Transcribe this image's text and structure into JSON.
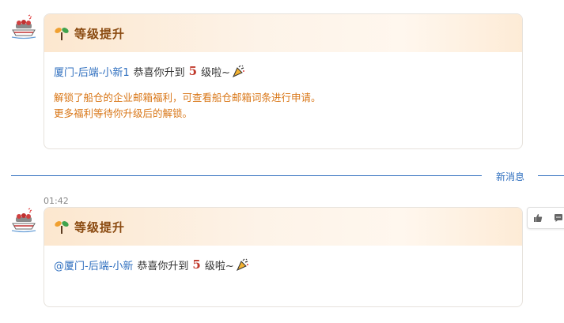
{
  "messages": [
    {
      "title": "等级提升",
      "user": "厦门-后端-小新1",
      "congrats": "恭喜你升到",
      "level": "5",
      "suffix": "级啦~",
      "benefits": [
        "解锁了船仓的企业邮箱福利，可查看船仓邮箱词条进行申请。",
        "更多福利等待你升级后的解锁。"
      ]
    },
    {
      "time": "01:42",
      "title": "等级提升",
      "user": "@厦门-后端-小新",
      "congrats": "恭喜你升到",
      "level": "5",
      "suffix": "级啦~"
    }
  ],
  "divider": {
    "label": "新消息"
  },
  "actions": [
    "thumbs-up-icon",
    "comment-icon"
  ],
  "colors": {
    "accent": "#2f6fbf",
    "benefit": "#d97718",
    "level": "#c0392b",
    "title": "#8a4a10"
  }
}
